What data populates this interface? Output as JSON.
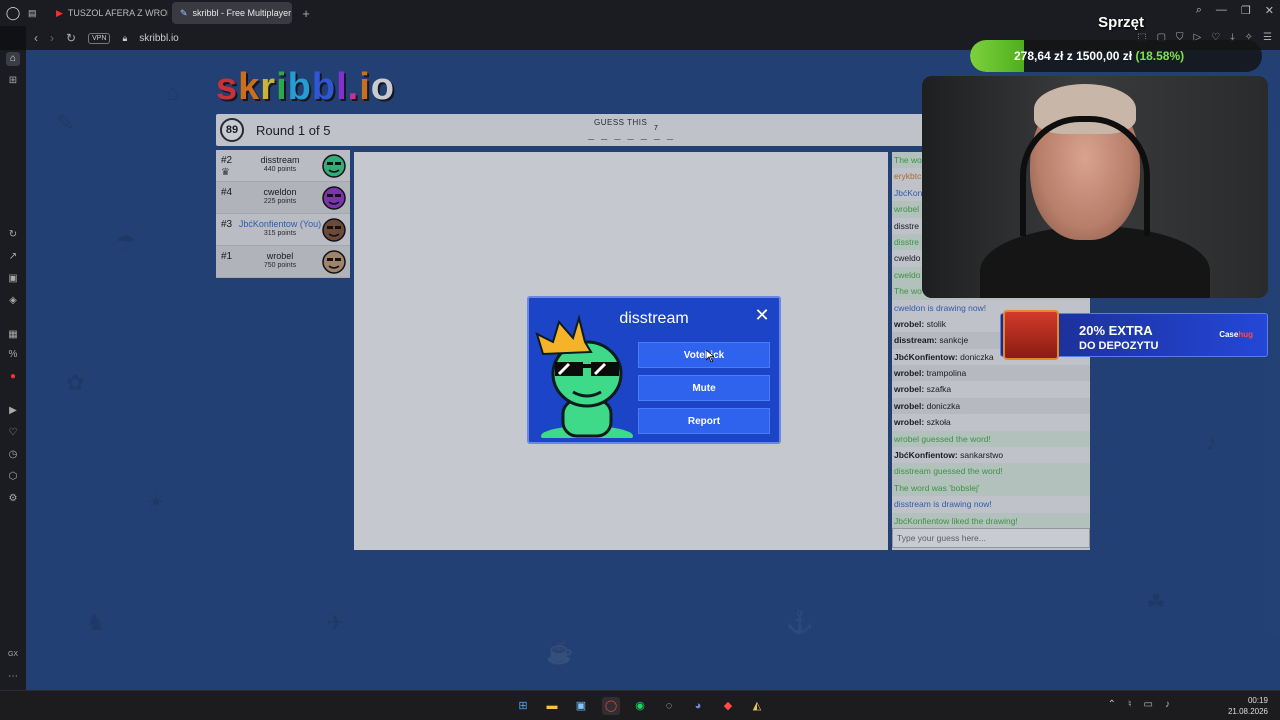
{
  "browser": {
    "tabs": [
      {
        "label": "TUSZOL AFERA Z WRONKI",
        "active": false,
        "icon": "youtube-icon"
      },
      {
        "label": "skribbl - Free Multiplayer D",
        "active": true,
        "icon": "skribbl-icon"
      }
    ],
    "url": "skribbl.io",
    "vpn_label": "VPN"
  },
  "game": {
    "logo_text": "skribbl.io",
    "timer": "89",
    "round": "Round 1 of 5",
    "guess_label": "GUESS THIS",
    "word_hint": "_ _ _ _ _ _ _",
    "word_length": "7",
    "players": [
      {
        "rank": "#2",
        "name": "disstream",
        "points": "440 points",
        "crown": true,
        "you": false,
        "color": "#3fd98a"
      },
      {
        "rank": "#4",
        "name": "cweldon",
        "points": "225 points",
        "crown": false,
        "you": false,
        "color": "#9a3fc9"
      },
      {
        "rank": "#3",
        "name": "JbćKonfientow (You)",
        "points": "315 points",
        "crown": false,
        "you": true,
        "color": "#8a5a3a"
      },
      {
        "rank": "#1",
        "name": "wrobel",
        "points": "750 points",
        "crown": false,
        "you": false,
        "color": "#c9a37a"
      }
    ],
    "chat": [
      {
        "text": "The wo",
        "style": "green"
      },
      {
        "text": "erykbtc",
        "style": "orange"
      },
      {
        "text": "JbćKon",
        "style": "blue"
      },
      {
        "text": "wrobel",
        "style": "green"
      },
      {
        "text": "disstre",
        "style": "plain"
      },
      {
        "text": "disstre",
        "style": "green"
      },
      {
        "text": "cweldo",
        "style": "plain"
      },
      {
        "text": "cweldo",
        "style": "green"
      },
      {
        "text": "The wo",
        "style": "green"
      },
      {
        "text": "cweldon is drawing now!",
        "style": "blue"
      },
      {
        "user": "wrobel:",
        "text": " stolik",
        "style": "plain"
      },
      {
        "user": "disstream:",
        "text": " sankcje",
        "style": "plain"
      },
      {
        "user": "JbćKonfientow:",
        "text": " doniczka",
        "style": "plain"
      },
      {
        "user": "wrobel:",
        "text": " trampolina",
        "style": "plain"
      },
      {
        "user": "wrobel:",
        "text": " szafka",
        "style": "plain"
      },
      {
        "user": "wrobel:",
        "text": " doniczka",
        "style": "plain"
      },
      {
        "user": "wrobel:",
        "text": " szkoła",
        "style": "plain"
      },
      {
        "text": "wrobel guessed the word!",
        "style": "green"
      },
      {
        "user": "JbćKonfientow:",
        "text": " sankarstwo",
        "style": "plain"
      },
      {
        "text": "disstream guessed the word!",
        "style": "green"
      },
      {
        "text": "The word was 'bobslej'",
        "style": "green"
      },
      {
        "text": "disstream is drawing now!",
        "style": "blue"
      },
      {
        "text": "JbćKonfientow liked the drawing!",
        "style": "green"
      }
    ],
    "chat_placeholder": "Type your guess here..."
  },
  "modal": {
    "player_name": "disstream",
    "close_symbol": "✕",
    "buttons": [
      "Votekick",
      "Mute",
      "Report"
    ]
  },
  "stream": {
    "goal_title": "Sprzęt",
    "goal_amount": "278,64 zł",
    "goal_connector": "z",
    "goal_total": "1500,00 zł",
    "goal_percent": "(18.58%)",
    "goal_fraction": 0.1858,
    "promo_line1": "20% EXTRA",
    "promo_line2": "DO DEPOZYTU",
    "promo_brand": "Case",
    "promo_brand_suffix": "hug"
  },
  "taskbar": {
    "time": "00:19",
    "date": "21.08.2026"
  },
  "colors": {
    "page_bg": "#2a4e86",
    "modal_bg": "#1c44c7",
    "button_blue": "#2f63ee",
    "goal_green": "#7ed13d"
  }
}
